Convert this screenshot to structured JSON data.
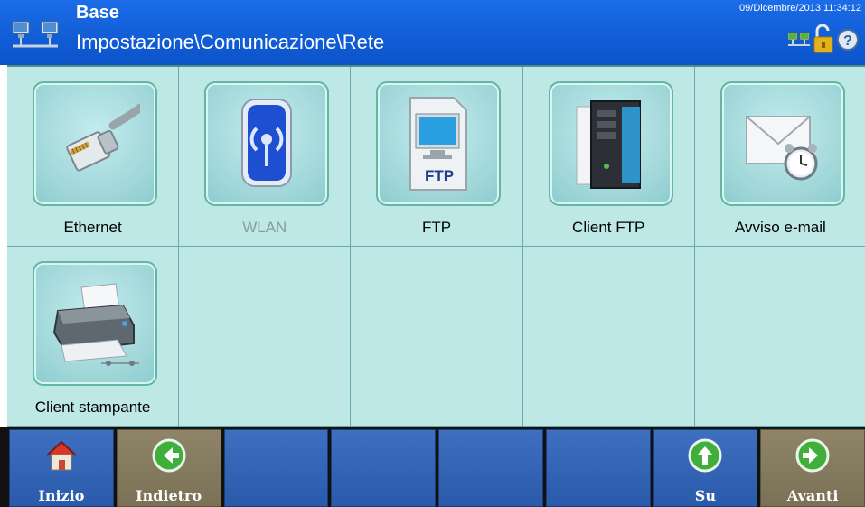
{
  "header": {
    "title": "Base",
    "path": "Impostazione\\Comunicazione\\Rete",
    "datetime": "09/Dicembre/2013 11:34:12"
  },
  "tiles": [
    {
      "label": "Ethernet",
      "icon": "ethernet-cable-icon",
      "enabled": true
    },
    {
      "label": "WLAN",
      "icon": "wlan-icon",
      "enabled": false
    },
    {
      "label": "FTP",
      "icon": "ftp-icon",
      "enabled": true
    },
    {
      "label": "Client FTP",
      "icon": "server-icon",
      "enabled": true
    },
    {
      "label": "Avviso e-mail",
      "icon": "email-alarm-icon",
      "enabled": true
    },
    {
      "label": "Client stampante",
      "icon": "printer-icon",
      "enabled": true
    }
  ],
  "buttons": [
    {
      "label": "Inizio",
      "icon": "home-icon"
    },
    {
      "label": "Indietro",
      "icon": "back-arrow-icon"
    },
    {
      "label": "",
      "icon": ""
    },
    {
      "label": "",
      "icon": ""
    },
    {
      "label": "",
      "icon": ""
    },
    {
      "label": "",
      "icon": ""
    },
    {
      "label": "Su",
      "icon": "up-arrow-icon"
    },
    {
      "label": "Avanti",
      "icon": "forward-arrow-icon"
    }
  ],
  "colors": {
    "header": "#0b53c9",
    "grid": "#bde8e6",
    "button_blue": "#2a5aaa",
    "button_tan": "#7a7156"
  }
}
